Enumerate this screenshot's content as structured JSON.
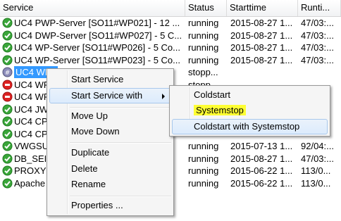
{
  "columns": [
    "Service",
    "Status",
    "Starttime",
    "Runti..."
  ],
  "rows": [
    {
      "icon": "ok",
      "name": "UC4 PWP-Server [SO11#WP021] - 12 ...",
      "status": "running",
      "start": "2015-08-27 1...",
      "runtime": "47/03:..."
    },
    {
      "icon": "ok",
      "name": "UC4 DWP-Server [SO11#WP027] - 5 C...",
      "status": "running",
      "start": "2015-08-27 1...",
      "runtime": "47/03:..."
    },
    {
      "icon": "ok",
      "name": "UC4 WP-Server [SO11#WP026] - 5 Co...",
      "status": "running",
      "start": "2015-08-27 1...",
      "runtime": "47/03:..."
    },
    {
      "icon": "ok",
      "name": "UC4 WP-Server [SO11#WP023] - 5 Co...",
      "status": "running",
      "start": "2015-08-27 1...",
      "runtime": "47/03:..."
    },
    {
      "icon": "stopped",
      "name": "UC4 WP3",
      "status": "stopp...",
      "start": "",
      "runtime": "",
      "selected": true
    },
    {
      "icon": "error",
      "name": "UC4 WP",
      "status": "stopp...",
      "start": "",
      "runtime": ""
    },
    {
      "icon": "error",
      "name": "UC4 WP",
      "status": "",
      "start": "",
      "runtime": ""
    },
    {
      "icon": "ok",
      "name": "UC4 JW",
      "status": "",
      "start": "",
      "runtime": ""
    },
    {
      "icon": "ok",
      "name": "UC4 CP",
      "status": "",
      "start": "",
      "runtime": ""
    },
    {
      "icon": "ok",
      "name": "UC4 CP",
      "status": "",
      "start": "",
      "runtime": ""
    },
    {
      "icon": "ok",
      "name": "VWGSU",
      "status": "running",
      "start": "2015-07-13 1...",
      "runtime": "92/04:..."
    },
    {
      "icon": "ok",
      "name": "DB_SEI",
      "status": "running",
      "start": "2015-08-27 1...",
      "runtime": "47/03:..."
    },
    {
      "icon": "ok",
      "name": "PROXY",
      "status": "running",
      "start": "2015-06-22 1...",
      "runtime": "113/0..."
    },
    {
      "icon": "ok",
      "name": "Apache",
      "status": "running",
      "start": "2015-06-22 1...",
      "runtime": "113/0..."
    }
  ],
  "context_menu": {
    "start_service": "Start Service",
    "start_service_with": "Start Service with",
    "move_up": "Move Up",
    "move_down": "Move Down",
    "duplicate": "Duplicate",
    "delete": "Delete",
    "rename": "Rename",
    "properties": "Properties ..."
  },
  "submenu": {
    "coldstart": "Coldstart",
    "systemstop": "Systemstop",
    "coldstart_with_systemstop": "Coldstart with Systemstop"
  },
  "colors": {
    "running": "#33aa33",
    "error": "#cc2222",
    "stopped": "#7777aa",
    "selection": "#3399ff",
    "highlight": "#ffff33"
  }
}
